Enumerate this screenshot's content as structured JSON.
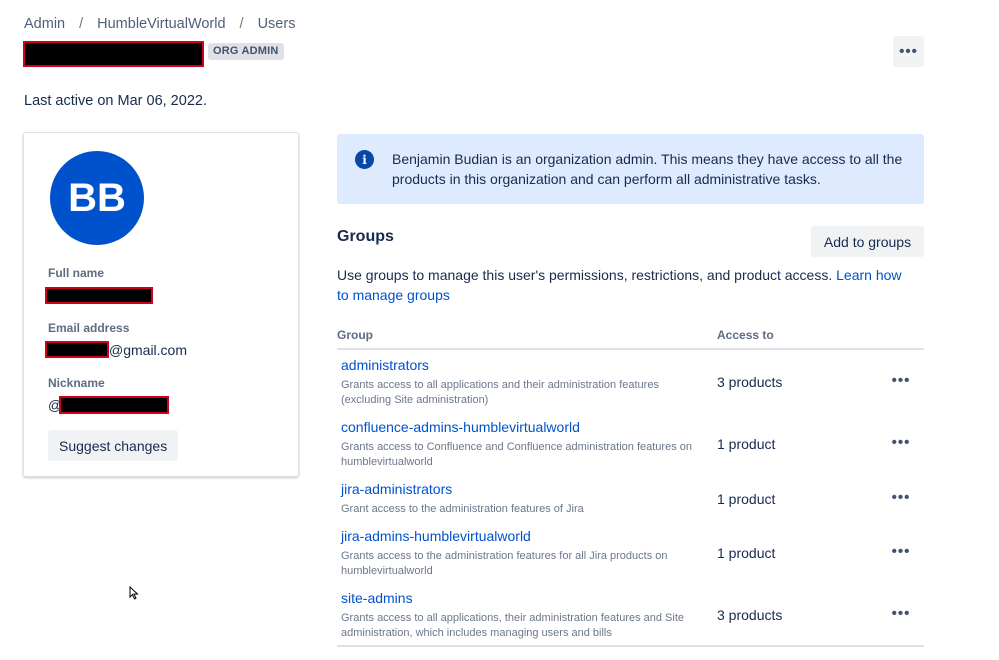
{
  "breadcrumb": [
    "Admin",
    "HumbleVirtualWorld",
    "Users"
  ],
  "header": {
    "badge": "ORG ADMIN",
    "more_icon": "more-horizontal-icon"
  },
  "last_active": "Last active on Mar 06, 2022.",
  "profile": {
    "avatar_initials": "BB",
    "avatar_color": "#0052cc",
    "full_name_label": "Full name",
    "email_label": "Email address",
    "email_suffix": "@gmail.com",
    "nickname_label": "Nickname",
    "nickname_prefix": "@",
    "suggest_button": "Suggest changes"
  },
  "info": {
    "icon": "info-icon",
    "text": "Benjamin Budian is an organization admin. This means they have access to all the products in this organization and can perform all administrative tasks."
  },
  "groups": {
    "title": "Groups",
    "add_button": "Add to groups",
    "description": "Use groups to manage this user's permissions, restrictions, and product access.",
    "learn_link": "Learn how to manage groups",
    "columns": [
      "Group",
      "Access to"
    ],
    "rows": [
      {
        "name": "administrators",
        "desc": "Grants access to all applications and their administration features (excluding Site administration)",
        "access": "3 products"
      },
      {
        "name": "confluence-admins-humblevirtualworld",
        "desc": "Grants access to Confluence and Confluence administration features on humblevirtualworld",
        "access": "1 product"
      },
      {
        "name": "jira-administrators",
        "desc": "Grant access to the administration features of Jira",
        "access": "1 product"
      },
      {
        "name": "jira-admins-humblevirtualworld",
        "desc": "Grants access to the administration features for all Jira products on humblevirtualworld",
        "access": "1 product"
      },
      {
        "name": "site-admins",
        "desc": "Grants access to all applications, their administration features and Site administration, which includes managing users and bills",
        "access": "3 products"
      }
    ]
  },
  "colors": {
    "link": "#0052cc",
    "info_bg": "#deebff",
    "redaction": "#000000",
    "redaction_border": "#d0021b"
  }
}
